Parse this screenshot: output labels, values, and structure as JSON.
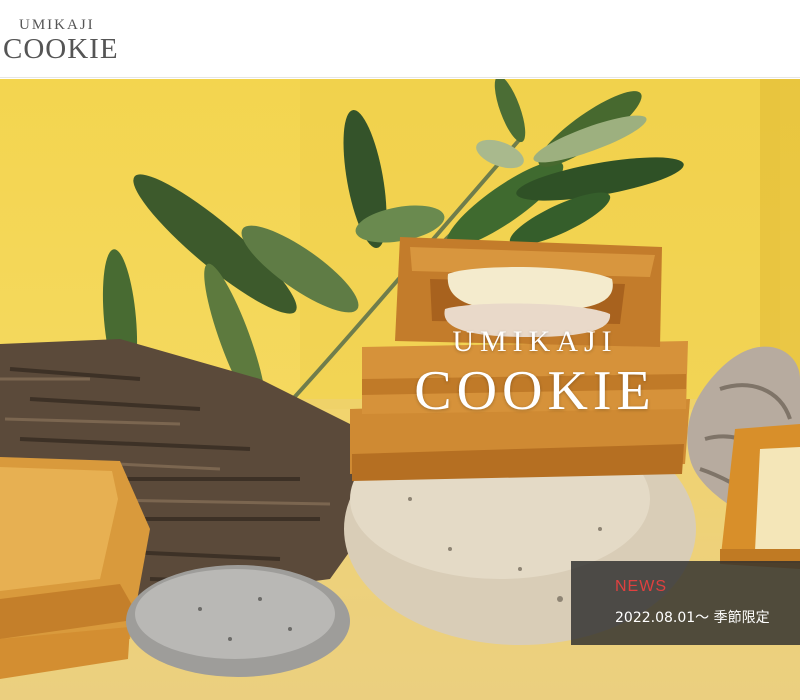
{
  "header": {
    "logo_top": "UMIKAJI",
    "logo_main": "COOKIE"
  },
  "hero": {
    "title_sub": "UMIKAJI",
    "title_main": "COOKIE"
  },
  "news": {
    "label": "NEWS",
    "item_text": "2022.08.01～ 季節限定"
  },
  "colors": {
    "background_yellow": "#f3d54f",
    "news_label": "#e0403f",
    "news_panel": "#2d2d2d",
    "logo_text": "#555555"
  }
}
